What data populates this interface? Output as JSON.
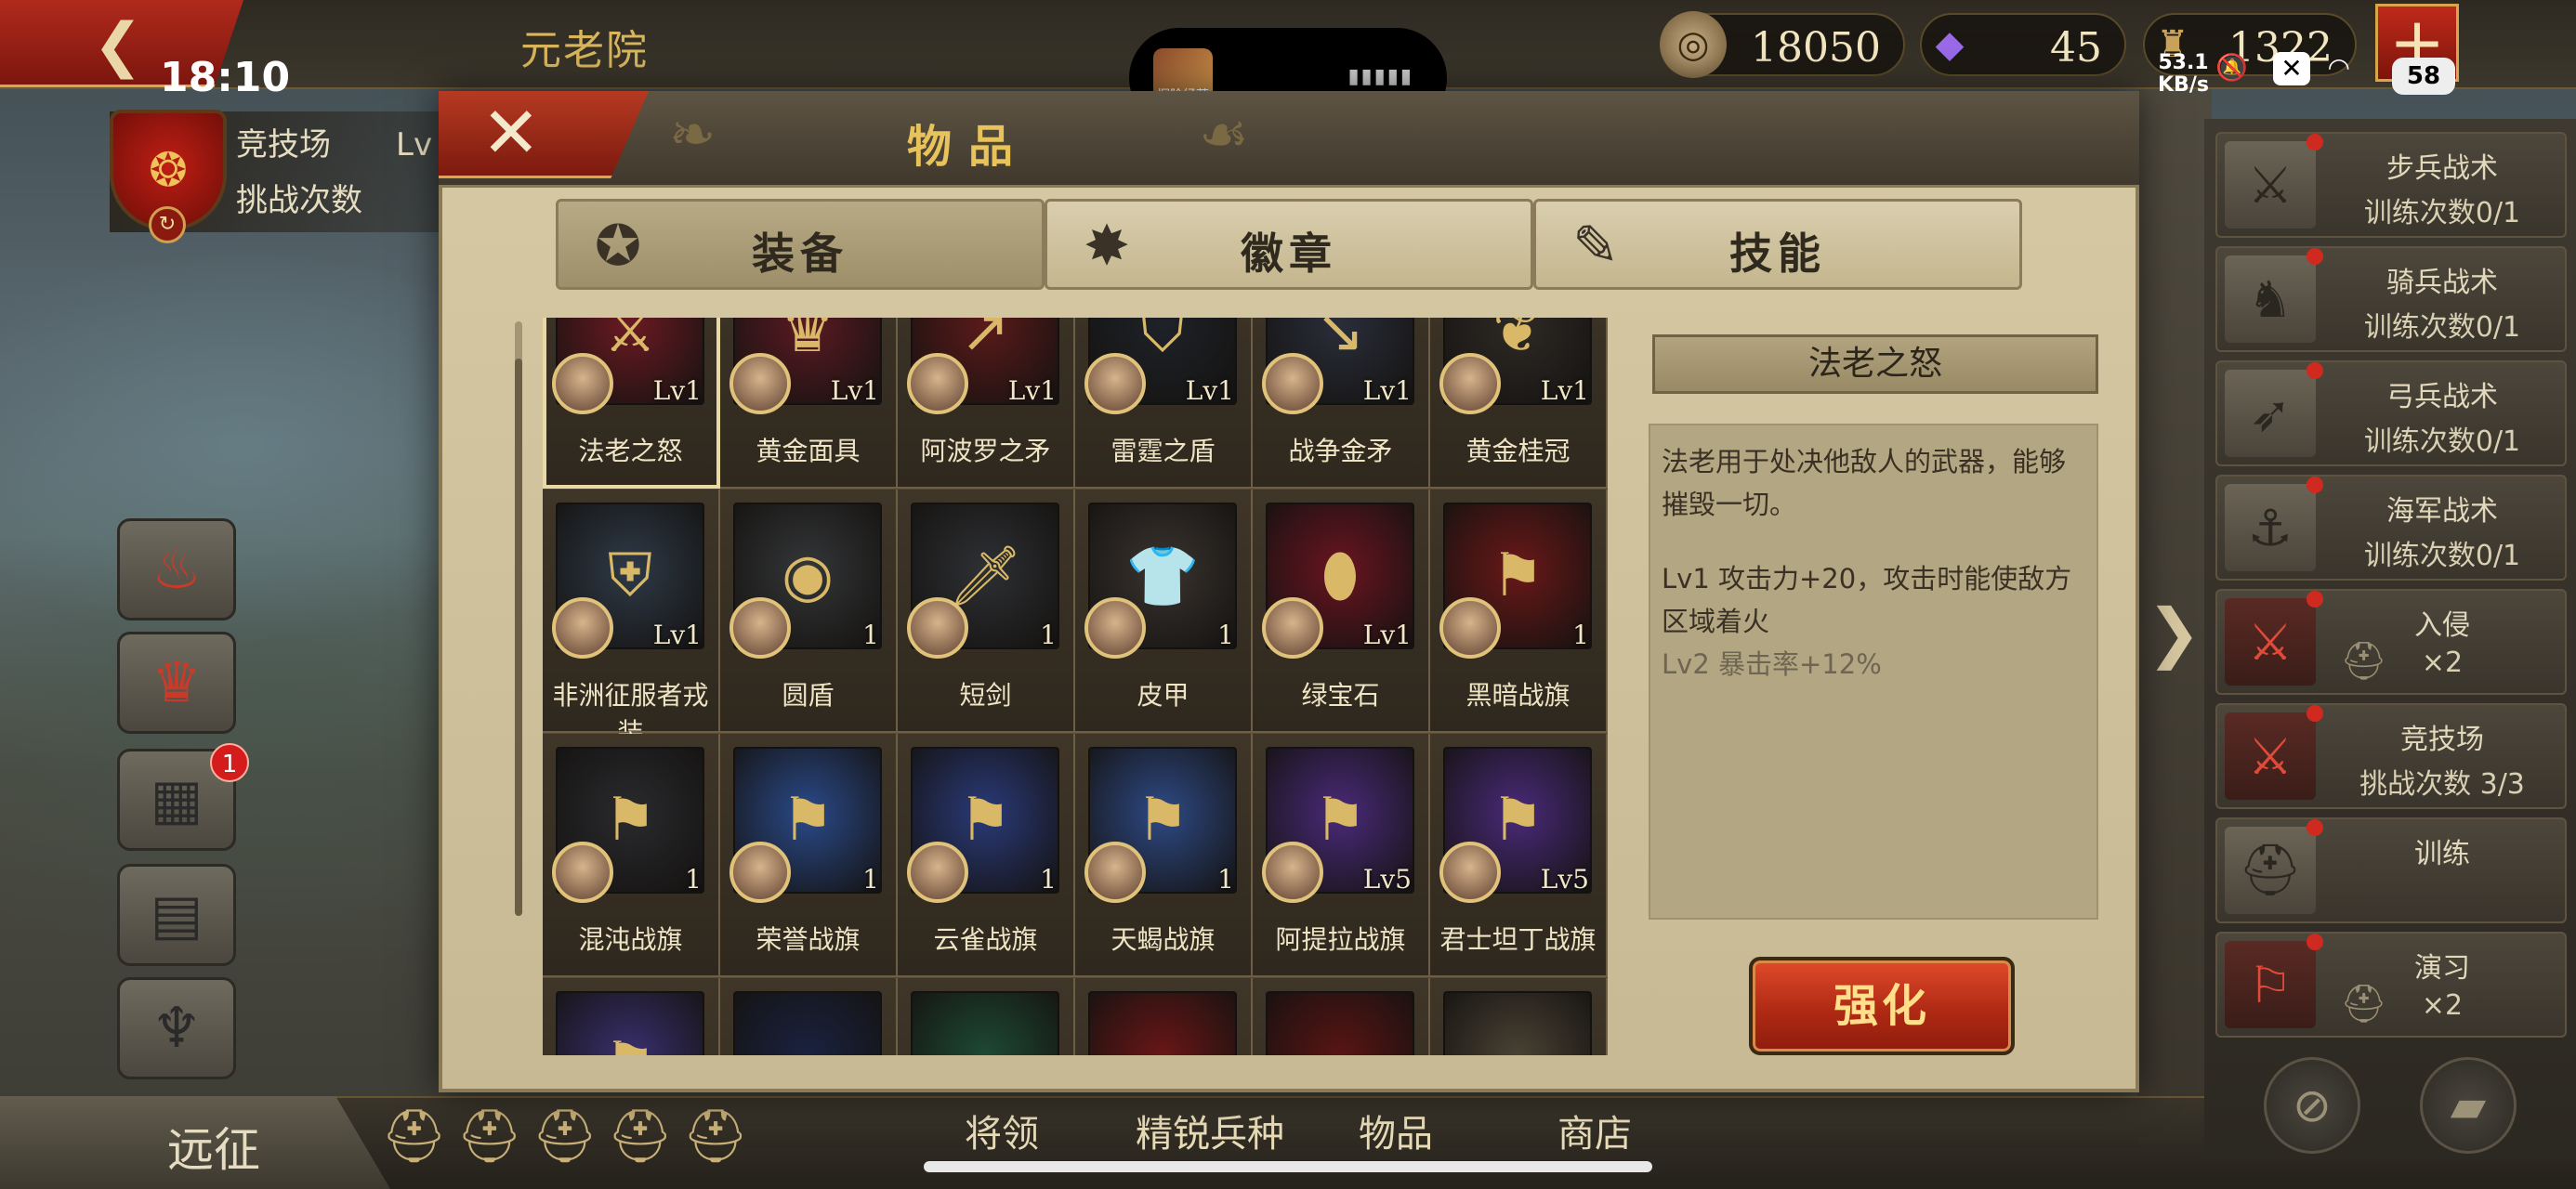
{
  "status_bar": {
    "time": "18:10",
    "net_speed_value": "53.1",
    "net_speed_unit": "KB/s",
    "battery": "58",
    "notch_thumb_text": "探险经营"
  },
  "top_bar": {
    "title": "元老院",
    "resources": {
      "coins": "18050",
      "gems": "45",
      "medals": "1322"
    }
  },
  "left": {
    "arena_title": "竞技场",
    "arena_level_abbr": "Lv",
    "arena_sub": "挑战次数",
    "video_badge": "1"
  },
  "modal": {
    "title": "物品",
    "tabs": [
      {
        "label": "装备",
        "icon": "equipment-icon",
        "active": true
      },
      {
        "label": "徽章",
        "icon": "badge-icon",
        "active": false
      },
      {
        "label": "技能",
        "icon": "skill-scroll-icon",
        "active": false
      }
    ],
    "items": [
      {
        "name": "法老之怒",
        "level": "Lv1",
        "color": "#6a1a22",
        "glyph": "⚔"
      },
      {
        "name": "黄金面具",
        "level": "Lv1",
        "color": "#5a1a22",
        "glyph": "♛"
      },
      {
        "name": "阿波罗之矛",
        "level": "Lv1",
        "color": "#5a1a1a",
        "glyph": "↗"
      },
      {
        "name": "雷霆之盾",
        "level": "Lv1",
        "color": "#1e2228",
        "glyph": "⛉"
      },
      {
        "name": "战争金矛",
        "level": "Lv1",
        "color": "#2a2e3a",
        "glyph": "↘"
      },
      {
        "name": "黄金桂冠",
        "level": "Lv1",
        "color": "#2e2a26",
        "glyph": "❦"
      },
      {
        "name": "非洲征服者戎装",
        "level": "Lv1",
        "color": "#2e3a48",
        "glyph": "⛨"
      },
      {
        "name": "圆盾",
        "level": "1",
        "color": "#343638",
        "glyph": "◉"
      },
      {
        "name": "短剑",
        "level": "1",
        "color": "#2e3034",
        "glyph": "🗡"
      },
      {
        "name": "皮甲",
        "level": "1",
        "color": "#3a3430",
        "glyph": "👕"
      },
      {
        "name": "绿宝石",
        "level": "Lv1",
        "color": "#6a1420",
        "glyph": "⬮"
      },
      {
        "name": "黑暗战旗",
        "level": "1",
        "color": "#6a1818",
        "glyph": "⚑"
      },
      {
        "name": "混沌战旗",
        "level": "1",
        "color": "#2a2a2e",
        "glyph": "⚑"
      },
      {
        "name": "荣誉战旗",
        "level": "1",
        "color": "#2a4a8a",
        "glyph": "⚑"
      },
      {
        "name": "云雀战旗",
        "level": "1",
        "color": "#2a3a7a",
        "glyph": "⚑"
      },
      {
        "name": "天蝎战旗",
        "level": "1",
        "color": "#2e4a86",
        "glyph": "⚑"
      },
      {
        "name": "阿提拉战旗",
        "level": "Lv5",
        "color": "#4a2a7a",
        "glyph": "⚑"
      },
      {
        "name": "君士坦丁战旗",
        "level": "Lv5",
        "color": "#4a2a7a",
        "glyph": "⚑"
      },
      {
        "name": "",
        "level": "",
        "color": "#3a3070",
        "glyph": "⚑"
      },
      {
        "name": "",
        "level": "",
        "color": "#1a2240",
        "glyph": ""
      },
      {
        "name": "",
        "level": "",
        "color": "#1e4a34",
        "glyph": ""
      },
      {
        "name": "",
        "level": "",
        "color": "#6a1616",
        "glyph": ""
      },
      {
        "name": "",
        "level": "",
        "color": "#5a1414",
        "glyph": ""
      },
      {
        "name": "",
        "level": "",
        "color": "#4a4234",
        "glyph": ""
      }
    ],
    "detail": {
      "title": "法老之怒",
      "description": "法老用于处决他敌人的武器，能够摧毁一切。",
      "lv1": "Lv1  攻击力+20，攻击时能使敌方区域着火",
      "lv2": "Lv2  暴击率+12%"
    },
    "enhance_label": "强化"
  },
  "right_panel": {
    "items": [
      {
        "title": "步兵战术",
        "sub": "训练次数0/1",
        "icon": "sword-icon",
        "red": false
      },
      {
        "title": "骑兵战术",
        "sub": "训练次数0/1",
        "icon": "horse-icon",
        "red": false
      },
      {
        "title": "弓兵战术",
        "sub": "训练次数0/1",
        "icon": "bow-icon",
        "red": false
      },
      {
        "title": "海军战术",
        "sub": "训练次数0/1",
        "icon": "anchor-icon",
        "red": false
      },
      {
        "title": "入侵",
        "sub": "×2",
        "icon": "crossed-swords-icon",
        "red": true
      },
      {
        "title": "竞技场",
        "sub": "挑战次数 3/3",
        "icon": "arena-icon",
        "red": true
      },
      {
        "title": "训练",
        "sub": "",
        "icon": "helmet-icon",
        "red": false
      },
      {
        "title": "演习",
        "sub": "×2",
        "icon": "drill-icon",
        "red": true
      }
    ]
  },
  "bottom_bar": {
    "expedition": "远征",
    "nav": [
      "将领",
      "精锐兵种",
      "物品",
      "商店"
    ]
  }
}
